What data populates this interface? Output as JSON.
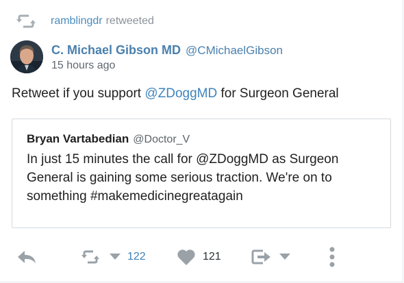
{
  "retweet_context": {
    "user": "ramblingdr",
    "suffix": "retweeted",
    "icon": "retweet-icon"
  },
  "tweet": {
    "author_name": "C. Michael Gibson MD",
    "author_handle": "@CMichaelGibson",
    "timestamp": "15 hours ago",
    "text_before": "Retweet if you support ",
    "mention": "@ZDoggMD",
    "text_after": " for Surgeon General"
  },
  "quoted_tweet": {
    "author_name": "Bryan Vartabedian",
    "author_handle": "@Doctor_V",
    "text": "In just 15 minutes the call for @ZDoggMD as Surgeon General is gaining some serious traction. We're on to something #makemedicinegreatagain"
  },
  "actions": {
    "reply_icon": "reply-icon",
    "retweet_icon": "retweet-icon",
    "retweet_count": "122",
    "like_icon": "heart-icon",
    "like_count": "121",
    "share_icon": "share-icon",
    "more_icon": "more-vertical-icon"
  },
  "colors": {
    "link": "#4a80ad",
    "icon_gray": "#9aa2a8",
    "border": "#d4d9dd"
  }
}
